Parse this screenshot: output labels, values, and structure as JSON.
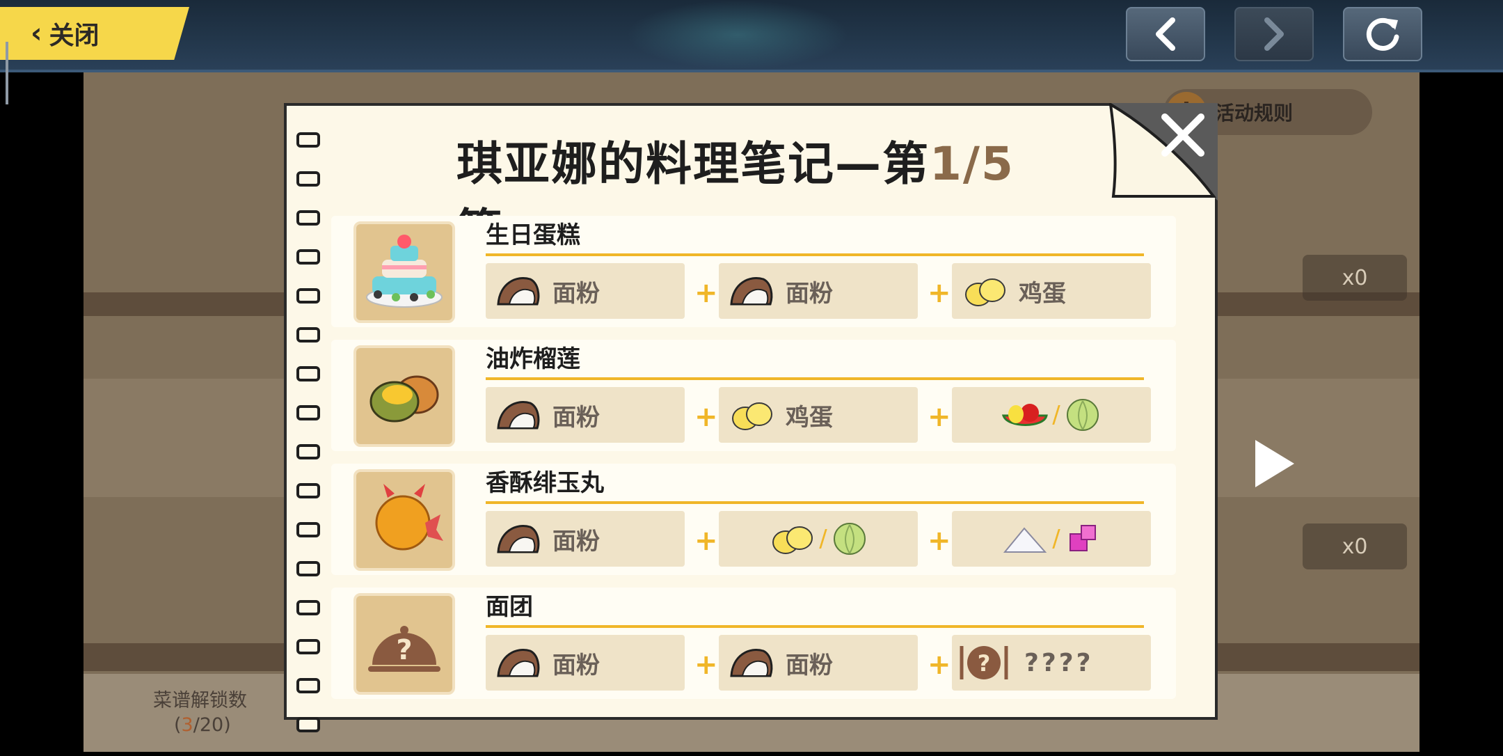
{
  "topbar": {
    "close_label": "关闭"
  },
  "background": {
    "rules_label": "活动规则",
    "rules_icon": "i",
    "counter_1": "x0",
    "counter_2": "x0",
    "unlock_label": "菜谱解锁数",
    "unlock_open": "(",
    "unlock_current": "3",
    "unlock_total": "/20)"
  },
  "dialog": {
    "title_prefix": "琪亚娜的料理笔记—第",
    "title_page": "1/5",
    "title_suffix": "篇",
    "recipes": [
      {
        "name": "生日蛋糕",
        "ingredients": [
          {
            "icon": "flour-icon",
            "label": "面粉"
          },
          {
            "icon": "flour-icon",
            "label": "面粉"
          },
          {
            "icon": "egg-icon",
            "label": "鸡蛋"
          }
        ]
      },
      {
        "name": "油炸榴莲",
        "ingredients": [
          {
            "icon": "flour-icon",
            "label": "面粉"
          },
          {
            "icon": "egg-icon",
            "label": "鸡蛋"
          },
          {
            "icons": [
              "fruit-icon",
              "cabbage-icon"
            ]
          }
        ]
      },
      {
        "name": "香酥绯玉丸",
        "ingredients": [
          {
            "icon": "flour-icon",
            "label": "面粉"
          },
          {
            "icons": [
              "egg-icon",
              "cabbage-icon"
            ]
          },
          {
            "icons": [
              "salt-icon",
              "candy-icon"
            ]
          }
        ]
      },
      {
        "name": "面团",
        "ingredients": [
          {
            "icon": "flour-icon",
            "label": "面粉"
          },
          {
            "icon": "flour-icon",
            "label": "面粉"
          },
          {
            "icon": "mystery-dish-icon",
            "label": "????"
          }
        ]
      }
    ],
    "plus": "+",
    "slash": "/"
  }
}
